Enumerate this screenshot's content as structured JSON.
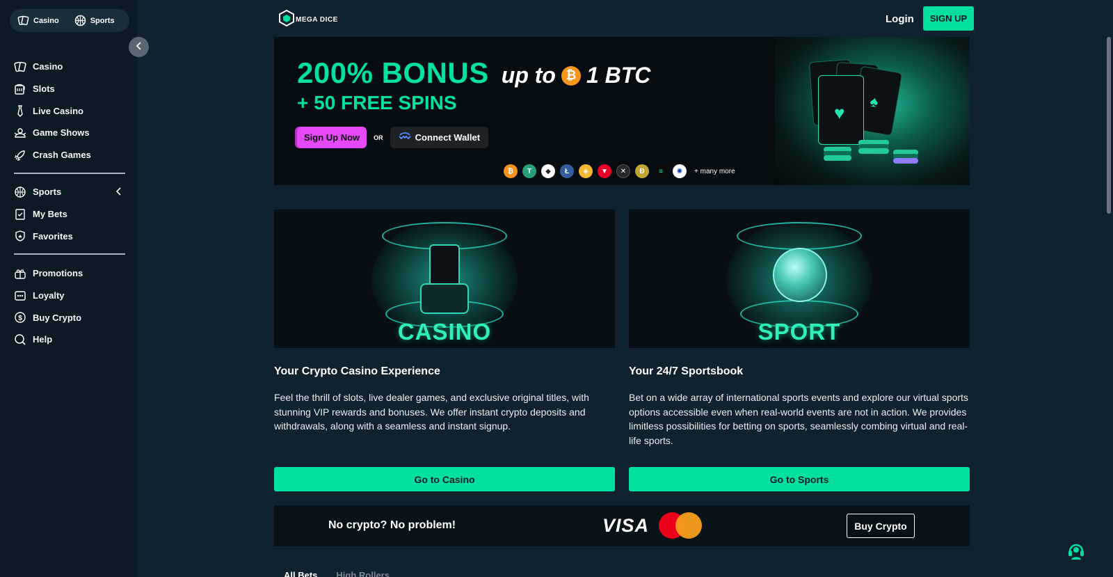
{
  "sidebar": {
    "mode_switch": {
      "casino": "Casino",
      "sports": "Sports"
    },
    "group1": [
      {
        "label": "Casino",
        "icon": "casino-icon"
      },
      {
        "label": "Slots",
        "icon": "slot-machine-icon"
      },
      {
        "label": "Live Casino",
        "icon": "tie-icon"
      },
      {
        "label": "Game Shows",
        "icon": "game-show-icon"
      },
      {
        "label": "Crash Games",
        "icon": "rocket-icon"
      }
    ],
    "group2": [
      {
        "label": "Sports",
        "icon": "basketball-icon"
      },
      {
        "label": "My Bets",
        "icon": "bet-slip-icon"
      },
      {
        "label": "Favorites",
        "icon": "favorites-shield-icon"
      }
    ],
    "group3": [
      {
        "label": "Promotions",
        "icon": "gift-icon"
      },
      {
        "label": "Loyalty",
        "icon": "loyalty-icon"
      },
      {
        "label": "Buy Crypto",
        "icon": "dollar-coin-icon"
      },
      {
        "label": "Help",
        "icon": "search-icon"
      }
    ]
  },
  "header": {
    "logo_text": "MEGA DICE",
    "login": "Login",
    "signup": "SIGN UP"
  },
  "hero": {
    "bonus": "200% BONUS",
    "up_to": "up to",
    "btc_amount": "1 BTC",
    "free_spins": "+ 50 FREE SPINS",
    "sign_up_now": "Sign Up Now",
    "or": "OR",
    "connect_wallet": "Connect Wallet",
    "many_more": "+ many more",
    "coins": [
      {
        "name": "bitcoin",
        "symbol": "₿",
        "color": "#f7931a"
      },
      {
        "name": "tether",
        "symbol": "T",
        "color": "#26a17b"
      },
      {
        "name": "ethereum",
        "symbol": "◆",
        "color": "#ffffff"
      },
      {
        "name": "litecoin",
        "symbol": "Ł",
        "color": "#345d9d"
      },
      {
        "name": "bnb",
        "symbol": "◈",
        "color": "#f3ba2f"
      },
      {
        "name": "tron",
        "symbol": "▼",
        "color": "#eb0029"
      },
      {
        "name": "xrp",
        "symbol": "✕",
        "color": "#23292f"
      },
      {
        "name": "dogecoin",
        "symbol": "Ð",
        "color": "#c2a633"
      },
      {
        "name": "solana",
        "symbol": "≡",
        "color": "#0b0b0b"
      },
      {
        "name": "cardano",
        "symbol": "✺",
        "color": "#ffffff"
      }
    ]
  },
  "features": {
    "casino": {
      "word": "CASINO",
      "title": "Your Crypto Casino Experience",
      "desc": "Feel the thrill of slots, live dealer games, and exclusive original titles, with stunning VIP rewards and bonuses. We offer instant crypto deposits and withdrawals, along with a seamless and instant signup.",
      "button": "Go to Casino"
    },
    "sport": {
      "word": "SPORT",
      "title": "Your 24/7 Sportsbook",
      "desc": "Bet on a wide array of international sports events and explore our virtual sports options accessible even when real-world events are not in action. We provides limitless possibilities for betting on sports, seamlessly combing virtual and real-life sports.",
      "button": "Go to Sports"
    }
  },
  "payments": {
    "no_crypto": "No crypto? No problem!",
    "visa": "VISA",
    "buy_crypto": "Buy Crypto"
  },
  "tabs": {
    "all_bets": "All Bets",
    "high_rollers": "High Rollers"
  },
  "colors": {
    "accent": "#00e0a0",
    "pink": "#e449f5",
    "background": "#10222d",
    "sidebar": "#0b1a23"
  }
}
